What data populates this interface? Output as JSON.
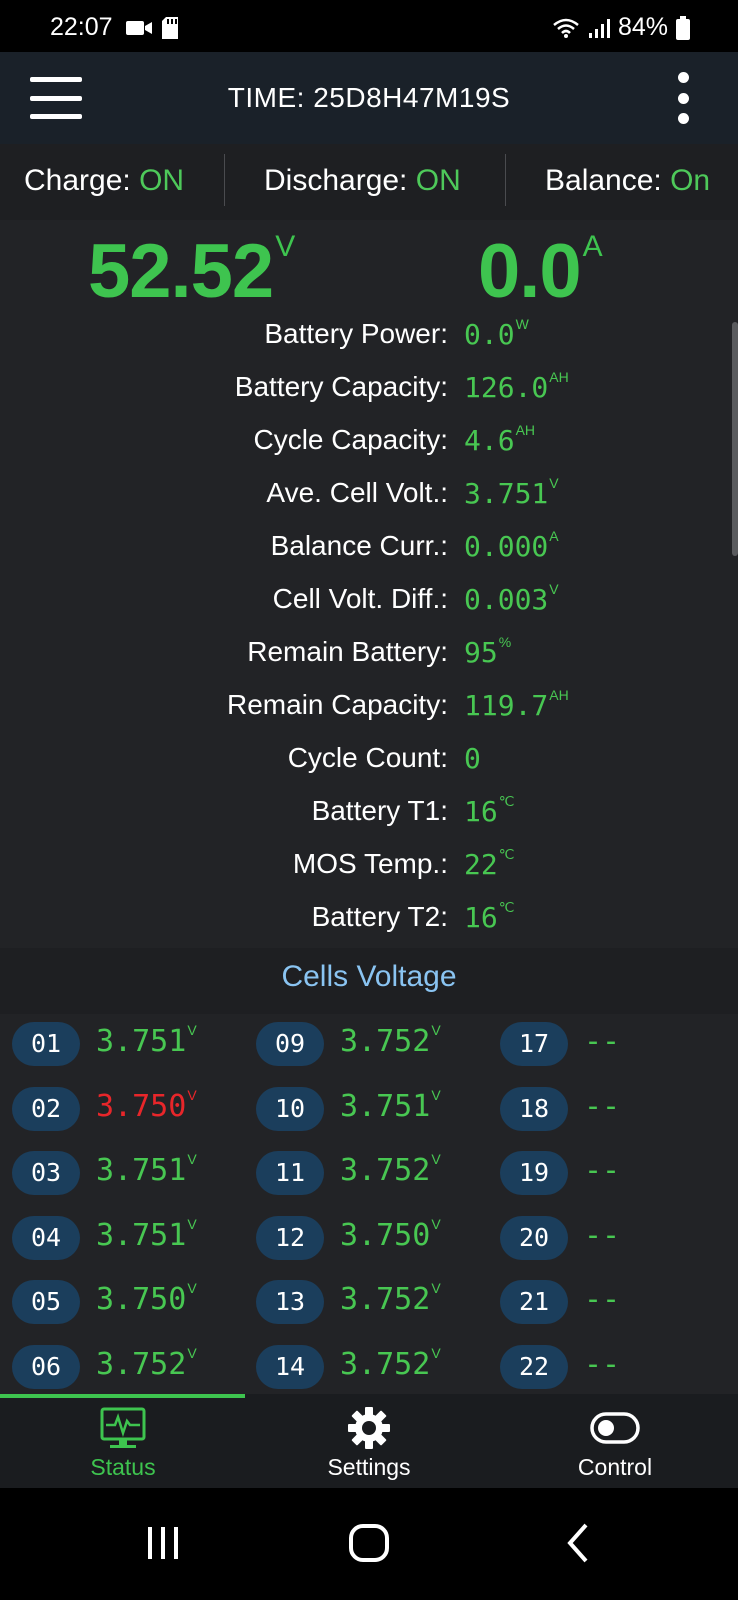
{
  "status_bar": {
    "time": "22:07",
    "battery_percent": "84%",
    "icons": [
      "video-icon",
      "sd-card-icon",
      "wifi-icon",
      "signal-icon",
      "battery-icon"
    ]
  },
  "top_bar": {
    "title": "TIME: 25D8H47M19S",
    "menu_icon": "hamburger-menu-icon",
    "more_icon": "more-vertical-icon"
  },
  "switches": [
    {
      "label": "Charge: ",
      "value": "ON"
    },
    {
      "label": "Discharge: ",
      "value": "ON"
    },
    {
      "label": "Balance: ",
      "value": "On"
    }
  ],
  "main": {
    "voltage": "52.52",
    "voltage_unit": "V",
    "current": "0.0",
    "current_unit": "A"
  },
  "stats": [
    {
      "label": "Battery Power:",
      "value": "0.0",
      "unit": "W"
    },
    {
      "label": "Battery Capacity:",
      "value": "126.0",
      "unit": "AH"
    },
    {
      "label": "Cycle Capacity:",
      "value": "4.6",
      "unit": "AH"
    },
    {
      "label": "Ave. Cell Volt.:",
      "value": "3.751",
      "unit": "V"
    },
    {
      "label": "Balance Curr.:",
      "value": "0.000",
      "unit": "A"
    },
    {
      "label": "Cell Volt. Diff.:",
      "value": "0.003",
      "unit": "V"
    },
    {
      "label": "Remain Battery:",
      "value": "95",
      "unit": "%"
    },
    {
      "label": "Remain Capacity:",
      "value": "119.7",
      "unit": "AH"
    },
    {
      "label": "Cycle Count:",
      "value": "0",
      "unit": ""
    },
    {
      "label": "Battery T1:",
      "value": "16",
      "unit": "℃"
    },
    {
      "label": "MOS Temp.:",
      "value": "22",
      "unit": "℃"
    },
    {
      "label": "Battery T2:",
      "value": "16",
      "unit": "℃"
    }
  ],
  "cells_title": "Cells Voltage",
  "cells": [
    [
      {
        "id": "01",
        "value": "3.751",
        "unit": "V",
        "low": false
      },
      {
        "id": "02",
        "value": "3.750",
        "unit": "V",
        "low": true
      },
      {
        "id": "03",
        "value": "3.751",
        "unit": "V",
        "low": false
      },
      {
        "id": "04",
        "value": "3.751",
        "unit": "V",
        "low": false
      },
      {
        "id": "05",
        "value": "3.750",
        "unit": "V",
        "low": false
      },
      {
        "id": "06",
        "value": "3.752",
        "unit": "V",
        "low": false
      }
    ],
    [
      {
        "id": "09",
        "value": "3.752",
        "unit": "V",
        "low": false
      },
      {
        "id": "10",
        "value": "3.751",
        "unit": "V",
        "low": false
      },
      {
        "id": "11",
        "value": "3.752",
        "unit": "V",
        "low": false
      },
      {
        "id": "12",
        "value": "3.750",
        "unit": "V",
        "low": false
      },
      {
        "id": "13",
        "value": "3.752",
        "unit": "V",
        "low": false
      },
      {
        "id": "14",
        "value": "3.752",
        "unit": "V",
        "low": false
      }
    ],
    [
      {
        "id": "17",
        "value": "--",
        "unit": "",
        "low": false
      },
      {
        "id": "18",
        "value": "--",
        "unit": "",
        "low": false
      },
      {
        "id": "19",
        "value": "--",
        "unit": "",
        "low": false
      },
      {
        "id": "20",
        "value": "--",
        "unit": "",
        "low": false
      },
      {
        "id": "21",
        "value": "--",
        "unit": "",
        "low": false
      },
      {
        "id": "22",
        "value": "--",
        "unit": "",
        "low": false
      }
    ]
  ],
  "bottom_nav": [
    {
      "label": "Status",
      "icon": "monitor-pulse-icon",
      "active": true
    },
    {
      "label": "Settings",
      "icon": "gear-icon",
      "active": false
    },
    {
      "label": "Control",
      "icon": "toggle-icon",
      "active": false
    }
  ],
  "colors": {
    "accent_green": "#3ec44f",
    "low_red": "#e8262a",
    "cell_badge": "#1b3e5c",
    "section_title": "#8ac4f2"
  }
}
